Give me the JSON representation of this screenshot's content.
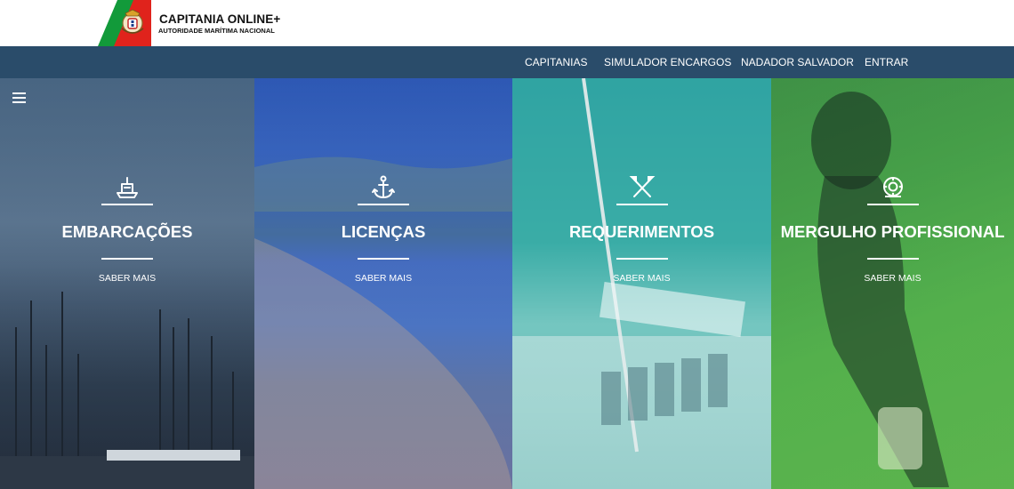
{
  "brand": {
    "title": "CAPITANIA ONLINE+",
    "subtitle": "AUTORIDADE MARÍTIMA NACIONAL",
    "colors": {
      "green": "#129a3a",
      "red": "#e0231c"
    }
  },
  "nav": {
    "items": [
      {
        "label": "CAPITANIAS"
      },
      {
        "label": "SIMULADOR ENCARGOS"
      },
      {
        "label": "NADADOR SALVADOR"
      },
      {
        "label": "ENTRAR"
      }
    ],
    "background": "#2a4c6a"
  },
  "menu": {
    "icon": "hamburger-menu-icon"
  },
  "panels": [
    {
      "icon": "boat-icon",
      "title": "EMBARCAÇÕES",
      "link": "SABER MAIS",
      "tint": "#2a4c6a"
    },
    {
      "icon": "anchor-icon",
      "title": "LICENÇAS",
      "link": "SABER MAIS",
      "tint": "#2350be"
    },
    {
      "icon": "crossed-oars-icon",
      "title": "REQUERIMENTOS",
      "link": "SABER MAIS",
      "tint": "#28aaa0"
    },
    {
      "icon": "diving-helmet-icon",
      "title": "MERGULHO PROFISSIONAL",
      "link": "SABER MAIS",
      "tint": "#50be50"
    }
  ]
}
